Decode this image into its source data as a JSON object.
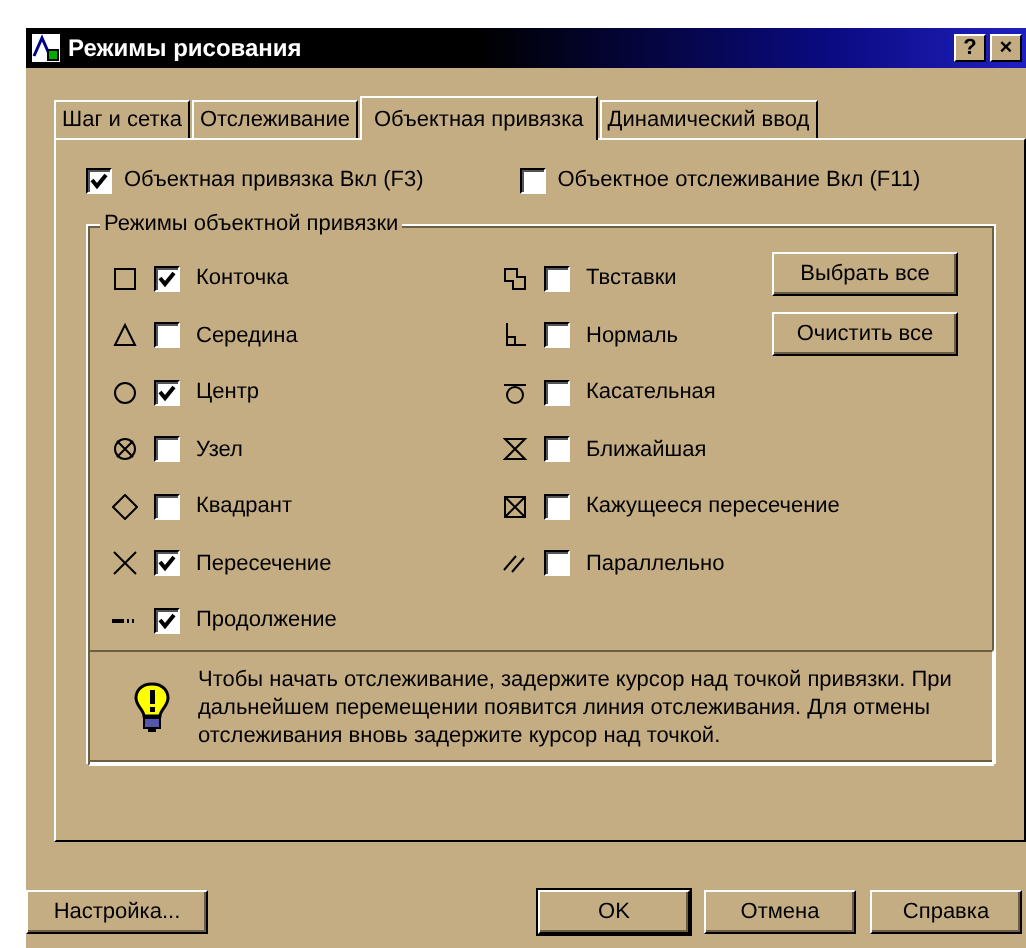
{
  "window": {
    "title": "Режимы рисования",
    "help": "?",
    "close": "×"
  },
  "tabs": [
    {
      "label": "Шаг и сетка",
      "selected": false
    },
    {
      "label": "Отслеживание",
      "selected": false
    },
    {
      "label": "Объектная привязка",
      "selected": true
    },
    {
      "label": "Динамический ввод",
      "selected": false
    }
  ],
  "toggles": [
    {
      "label": "Объектная привязка Вкл (F3)",
      "checked": true
    },
    {
      "label": "Объектное отслеживание Вкл (F11)",
      "checked": false
    }
  ],
  "group": {
    "title": "Режимы объектной привязки",
    "left": [
      {
        "kind": "square",
        "label": "Конточка",
        "checked": true
      },
      {
        "kind": "triangle",
        "label": "Середина",
        "checked": false
      },
      {
        "kind": "circle",
        "label": "Центр",
        "checked": true
      },
      {
        "kind": "node",
        "label": "Узел",
        "checked": false
      },
      {
        "kind": "diamond",
        "label": "Квадрант",
        "checked": false
      },
      {
        "kind": "cross",
        "label": "Пересечение",
        "checked": true
      },
      {
        "kind": "extension",
        "label": "Продолжение",
        "checked": true
      }
    ],
    "right": [
      {
        "kind": "insertion",
        "label": "Твставки",
        "checked": false
      },
      {
        "kind": "perpendicular",
        "label": "Нормаль",
        "checked": false
      },
      {
        "kind": "tangent",
        "label": "Касательная",
        "checked": false
      },
      {
        "kind": "nearest",
        "label": "Ближайшая",
        "checked": false
      },
      {
        "kind": "apparent",
        "label": "Кажущееся пересечение",
        "checked": false
      },
      {
        "kind": "parallel",
        "label": "Параллельно",
        "checked": false
      }
    ],
    "buttons": [
      "Выбрать все",
      "Очистить все"
    ]
  },
  "hint": "Чтобы начать отслеживание, задержите курсор над точкой привязки. При дальнейшем перемещении появится линия отслеживания. Для отмены отслеживания вновь задержите курсор над точкой.",
  "footer": {
    "left": "Настройка...",
    "right": [
      "OK",
      "Отмена",
      "Справка"
    ]
  }
}
